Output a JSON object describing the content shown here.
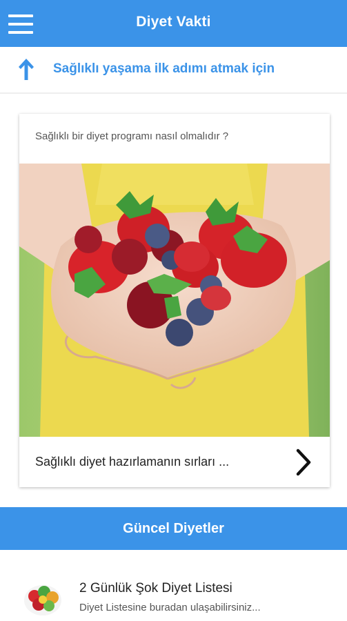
{
  "app": {
    "title": "Diyet Vakti",
    "menu_icon": "hamburger-menu-icon",
    "accent": "#3b93e8"
  },
  "promo": {
    "icon": "arrow-up-icon",
    "text": "Sağlıklı yaşama ilk adımı atmak için"
  },
  "card": {
    "question": "Sağlıklı bir diyet programı nasıl olmalıdır ?",
    "image": "hands-holding-berries-photo",
    "footer_text": "Sağlıklı diyet hazırlamanın sırları ...",
    "footer_icon": "chevron-right-icon"
  },
  "section": {
    "title": "Güncel Diyetler"
  },
  "list": {
    "items": [
      {
        "title": "2 Günlük Şok Diyet Listesi",
        "subtitle": "Diyet Listesine buradan ulaşabilirsiniz...",
        "thumb": "fruit-bowl-thumbnail"
      }
    ]
  }
}
